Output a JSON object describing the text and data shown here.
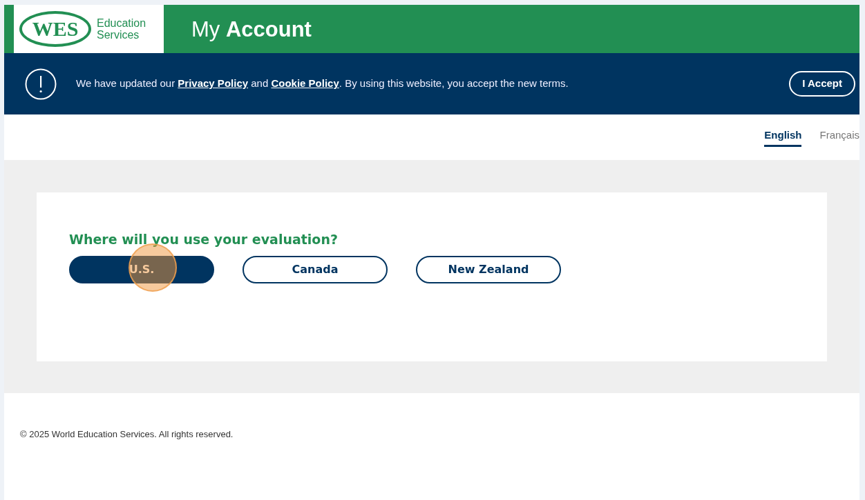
{
  "header": {
    "logo_text": "WES",
    "logo_subtitle": [
      "Education",
      "Services"
    ],
    "title_light": "My",
    "title_bold": "Account"
  },
  "notice": {
    "text_before": "We have updated our ",
    "link_1": "Privacy Policy",
    "text_middle": " and ",
    "link_2": "Cookie Policy",
    "text_after": ". By using this website, you accept the new terms.",
    "button": "I Accept"
  },
  "languages": [
    {
      "label": "English",
      "selected": true
    },
    {
      "label": "Français",
      "selected": false
    }
  ],
  "question": "Where will you use your evaluation?",
  "options": [
    {
      "label": "U.S.",
      "selected": true,
      "clicked": true
    },
    {
      "label": "Canada",
      "selected": false,
      "clicked": false
    },
    {
      "label": "New Zealand",
      "selected": false,
      "clicked": false
    }
  ],
  "footer": "© 2025 World Education Services. All rights reserved."
}
